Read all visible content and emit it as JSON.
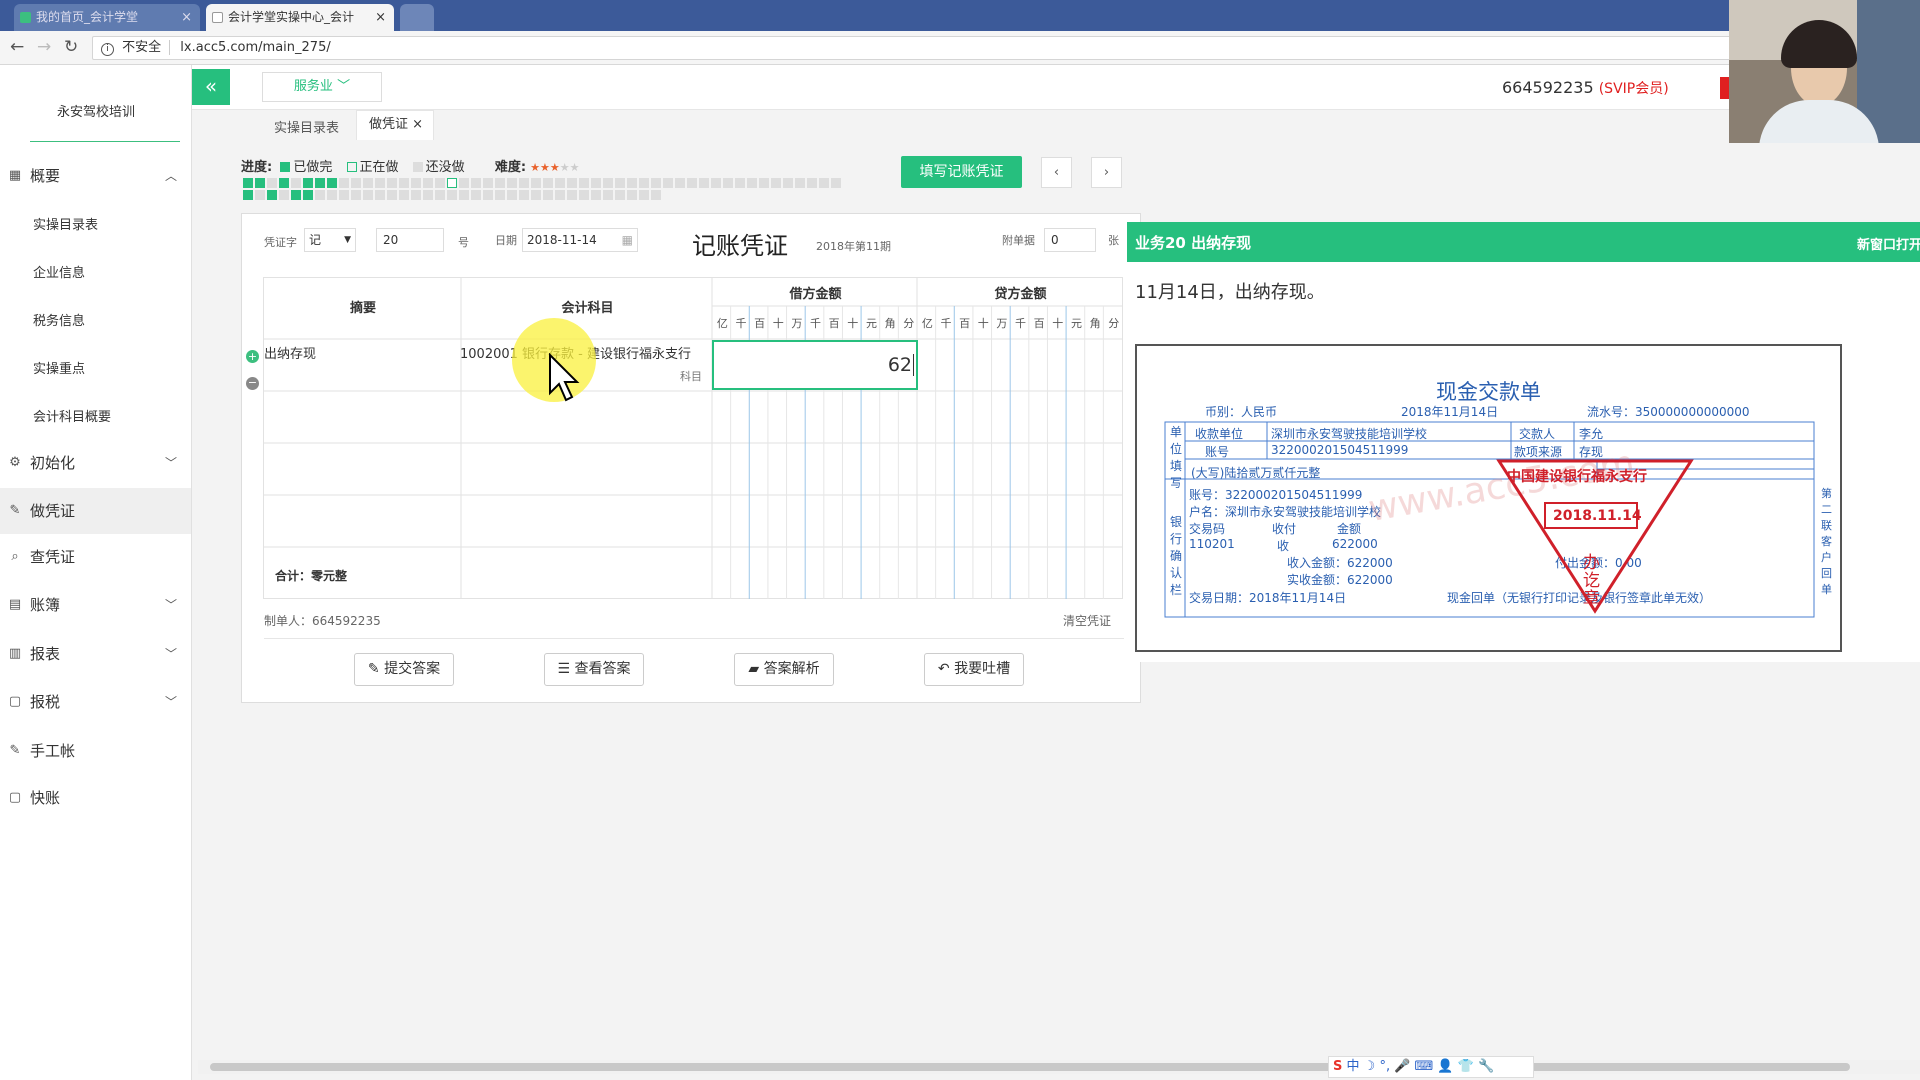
{
  "browser": {
    "tabs": [
      {
        "label": "我的首页_会计学堂"
      },
      {
        "label": "会计学堂实操中心_会计"
      }
    ],
    "url": "lx.acc5.com/main_275/",
    "security": "不安全"
  },
  "sidebar": {
    "school": "永安驾校培训",
    "menu": [
      {
        "label": "概要",
        "icon": "overview-icon"
      },
      {
        "label": "初始化",
        "icon": "gear-icon"
      },
      {
        "label": "做凭证",
        "icon": "pencil-icon"
      },
      {
        "label": "查凭证",
        "icon": "search-icon"
      },
      {
        "label": "账簿",
        "icon": "book-icon"
      },
      {
        "label": "报表",
        "icon": "report-icon"
      },
      {
        "label": "报税",
        "icon": "doc-icon"
      },
      {
        "label": "手工帐",
        "icon": "pencil-icon"
      },
      {
        "label": "快账",
        "icon": "doc-icon"
      }
    ],
    "submenu": [
      "实操目录表",
      "企业信息",
      "税务信息",
      "实操重点",
      "会计科目概要"
    ]
  },
  "topbar": {
    "industry": "服务业",
    "account": "664592235",
    "vip": "(SVIP会员)"
  },
  "tabs": {
    "catalog": "实操目录表",
    "voucher": "做凭证"
  },
  "progress": {
    "label": "进度:",
    "done": "已做完",
    "doing": "正在做",
    "todo": "还没做",
    "difficulty": "难度:",
    "fill_btn": "填写记账凭证"
  },
  "voucher": {
    "word_label": "凭证字",
    "word": "记",
    "number": "20",
    "hao": "号",
    "date_label": "日期",
    "date": "2018-11-14",
    "title": "记账凭证",
    "period": "2018年第11期",
    "attach_label": "附单据",
    "attach": "0",
    "zhang": "张",
    "col_summary": "摘要",
    "col_account": "会计科目",
    "col_debit": "借方金额",
    "col_credit": "贷方金额",
    "digits": [
      "亿",
      "千",
      "百",
      "十",
      "万",
      "千",
      "百",
      "十",
      "元",
      "角",
      "分"
    ],
    "row_summary": "出纳存现",
    "row_account": "1002001 银行存款 - 建设银行福永支行",
    "row_account_hint": "科目",
    "row_amount": "62",
    "total": "合计：零元整",
    "maker": "制单人：664592235",
    "clear": "清空凭证"
  },
  "buttons": {
    "submit": "提交答案",
    "view": "查看答案",
    "analysis": "答案解析",
    "feedback": "我要吐槽"
  },
  "task": {
    "title": "业务20 出纳存现",
    "open": "新窗口打开",
    "desc": "11月14日，出纳存现。"
  },
  "receipt": {
    "title": "现金交款单",
    "currency": "币别：人民币",
    "date": "2018年11月14日",
    "serial": "流水号：350000000000000",
    "payee_label": "收款单位",
    "payee": "深圳市永安驾驶技能培训学校",
    "payer_label": "交款人",
    "payer": "李允",
    "acct_label": "账号",
    "acct": "322000201504511999",
    "source_label": "款项来源",
    "source": "存现",
    "amount_words": "(大写)陆拾贰万贰仟元整",
    "side_left": "单位填写",
    "side_bank": "银行确认栏",
    "bank_acct": "账号：322000201504511999",
    "bank_name": "户名：深圳市永安驾驶技能培训学校",
    "code_label": "交易码",
    "code": "110201",
    "cash": "收付",
    "cash_val": "收",
    "amt_label": "金额",
    "amt": "622000",
    "recv": "收入金额：622000",
    "paid": "实收金额：622000",
    "out": "付出金额：0.00",
    "tdate": "交易日期：2018年11月14日",
    "note": "现金回单（无银行打印记录及银行签章此单无效）",
    "stamp_bank": "中国建设银行福永支行",
    "stamp_date": "2018.11.14",
    "stamp_seal": "办讫章",
    "watermark": "www.acc5.com",
    "lian": "第二联客户回单"
  },
  "colors": {
    "green": "#26bf7e",
    "red": "#e02020",
    "stamp": "#d0202a"
  }
}
